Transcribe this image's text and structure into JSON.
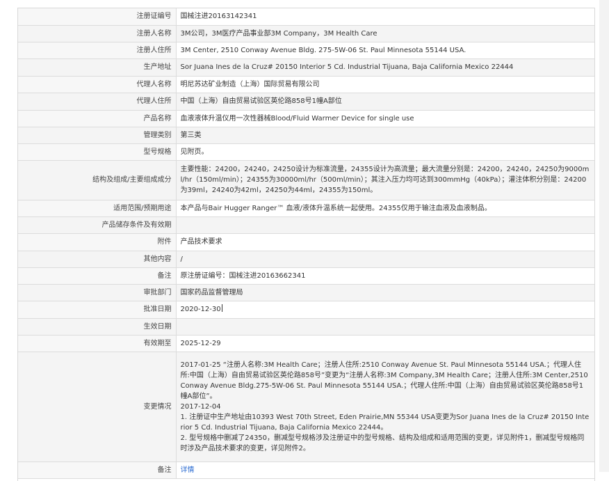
{
  "rows": [
    {
      "label": "注册证编号",
      "value": "国械注进20163142341"
    },
    {
      "label": "注册人名称",
      "value": "3M公司，3M医疗产品事业部3M Company，3M Health Care"
    },
    {
      "label": "注册人住所",
      "value": "3M Center, 2510 Conway Avenue Bldg. 275-5W-06 St. Paul Minnesota 55144 USA."
    },
    {
      "label": "生产地址",
      "value": "Sor Juana Ines de la Cruz# 20150 Interior 5 Cd. Industrial Tijuana, Baja California Mexico 22444"
    },
    {
      "label": "代理人名称",
      "value": "明尼苏达矿业制造（上海）国际贸易有限公司"
    },
    {
      "label": "代理人住所",
      "value": "中国（上海）自由贸易试验区英伦路858号1幢A部位"
    },
    {
      "label": "产品名称",
      "value": "血液液体升温仪用一次性器械Blood/Fluid Warmer Device for single use"
    },
    {
      "label": "管理类别",
      "value": "第三类"
    },
    {
      "label": "型号规格",
      "value": "见附页。"
    },
    {
      "label": "结构及组成/主要组成成分",
      "value": "主要性能：24200，24240，24250设计为标准流量，24355设计为高流量；最大流量分别是：24200，24240，24250为9000ml/hr（150ml/min）；24355为30000ml/hr（500ml/min）；其注入压力均可达到300mmHg（40kPa）；灌注体积分别是：24200为39ml，24240为42ml，24250为44ml，24355为150ml。"
    },
    {
      "label": "适用范围/预期用途",
      "value": "本产品与Bair Hugger Ranger™ 血液/液体升温系统一起使用。24355仅用于输注血液及血液制品。"
    },
    {
      "label": "产品储存条件及有效期",
      "value": ""
    },
    {
      "label": "附件",
      "value": "产品技术要求"
    },
    {
      "label": "其他内容",
      "value": "/"
    },
    {
      "label": "备注",
      "value": "原注册证编号：国械注进20163662341"
    },
    {
      "label": "审批部门",
      "value": "国家药品监督管理局"
    },
    {
      "label": "批准日期",
      "value": "2020-12-30"
    },
    {
      "label": "生效日期",
      "value": ""
    },
    {
      "label": "有效期至",
      "value": "2025-12-29"
    }
  ],
  "change": {
    "label": "变更情况",
    "lines": [
      "2017-01-25 “注册人名称:3M Health Care；注册人住所:2510 Conway Avenue St. Paul Minnesota 55144 USA.；代理人住所:中国（上海）自由贸易试验区英伦路858号”变更为“注册人名称:3M Company,3M Health Care；注册人住所:3M Center,2510 Conway Avenue Bldg.275-5W-06 St. Paul Minnesota 55144 USA.；代理人住所:中国（上海）自由贸易试验区英伦路858号1幢A部位”。",
      "2017-12-04",
      "1. 注册证中生产地址由10393 West 70th Street, Eden Prairie,MN 55344 USA变更为Sor Juana Ines de la Cruz# 20150 Interior 5 Cd. Industrial Tijuana, Baja California Mexico 22444。",
      "2. 型号规格中删减了24350，删减型号规格涉及注册证中的型号规格、结构及组成和适用范围的变更，详见附件1，删减型号规格同时涉及产品技术要求的变更，详见附件2。"
    ]
  },
  "detail": {
    "label": "备注",
    "link": "详情"
  }
}
